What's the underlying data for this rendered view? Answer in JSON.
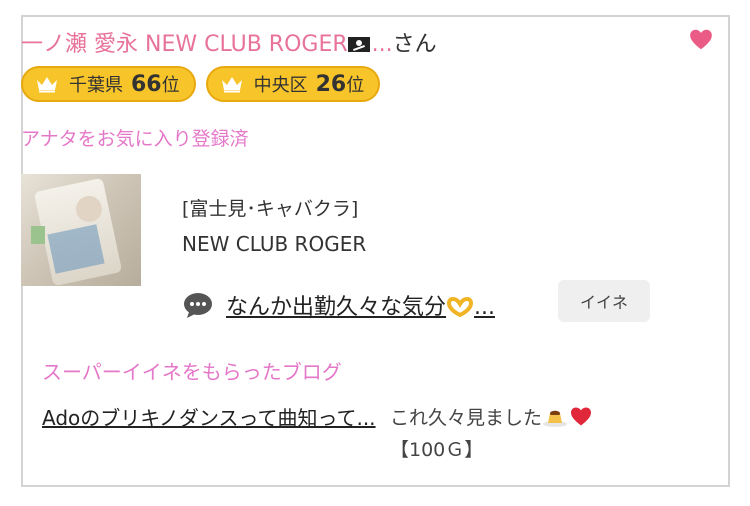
{
  "header": {
    "user_name": "一ノ瀬 愛永 NEW CLUB ROGER",
    "ellipsis": "...",
    "honorific": "さん"
  },
  "badges": [
    {
      "area": "千葉県",
      "rank": "66",
      "unit": "位"
    },
    {
      "area": "中央区",
      "rank": "26",
      "unit": "位"
    }
  ],
  "favorite_status": "アナタをお気に入り登録済",
  "shop": {
    "area_genre": "[富士見･キャバクラ]",
    "name": "NEW CLUB ROGER"
  },
  "latest_blog": {
    "title": "なんか出勤久々な気分",
    "ellipsis": "...",
    "iine_button": "イイネ"
  },
  "super_iine": {
    "label": "スーパーイイネをもらったブログ",
    "blog_link": "Adoのブリキノダンスって曲知って...",
    "comment": "これ久々見ました",
    "points": "【100Ｇ】"
  },
  "colors": {
    "accent_pink": "#e8739a",
    "label_pink": "#e577c9",
    "badge_gold": "#f7c42a",
    "heart": "#ea5b85"
  }
}
